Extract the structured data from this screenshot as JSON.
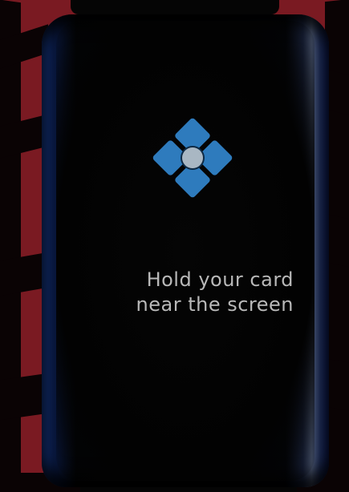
{
  "prompt": {
    "line1": "Hold your card",
    "line2": "near the screen"
  },
  "icon": {
    "name": "nfc-card-reader-icon",
    "petal_color": "#2e7bbd",
    "center_color": "#a9b7c3"
  },
  "colors": {
    "background_red": "#7a1a22",
    "terminal_edge_blue": "#163a8a",
    "screen_black": "#020203",
    "text_gray": "#b9b9b9"
  }
}
